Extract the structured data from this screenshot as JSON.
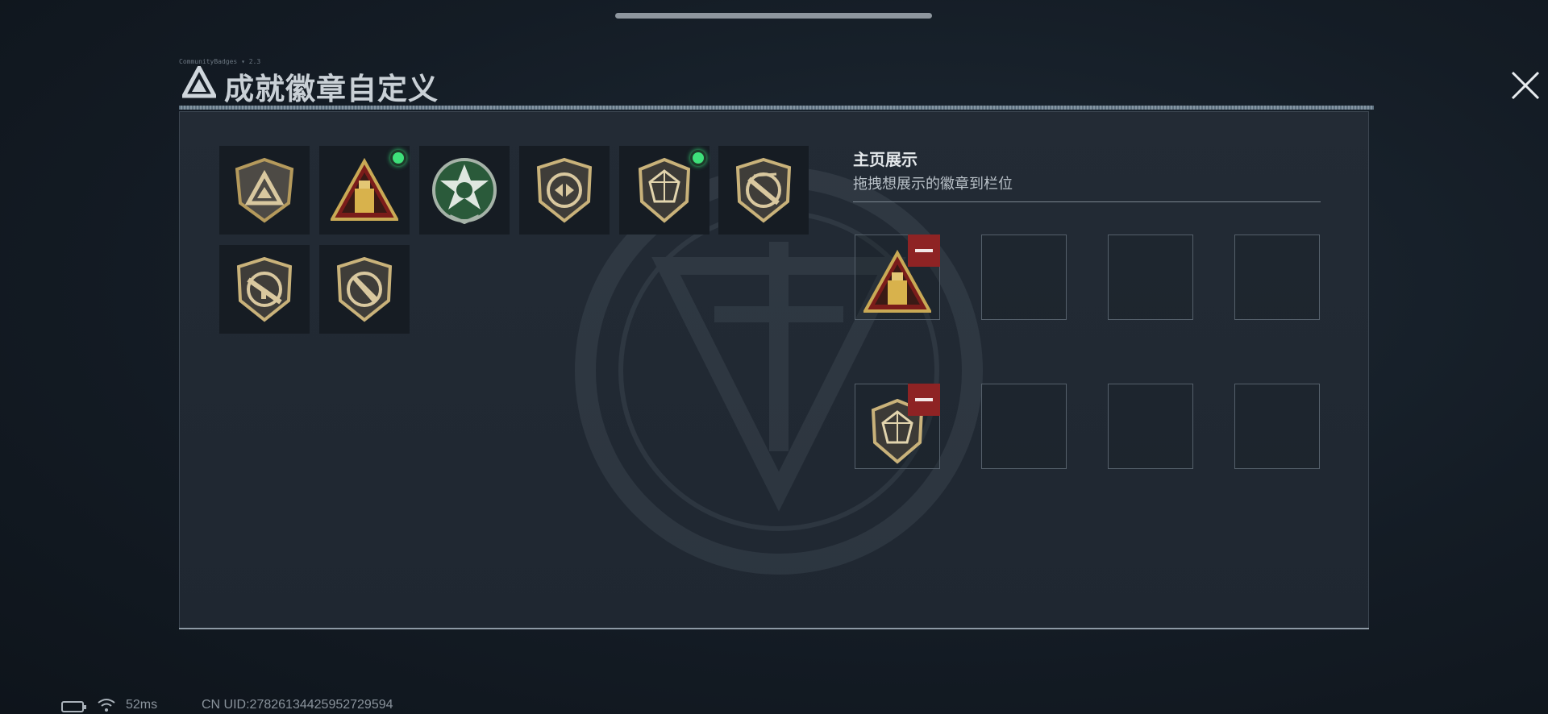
{
  "window": {
    "title": "成就徽章自定义",
    "title_tiny": "CommunityBadges ▾ 2.3"
  },
  "badges": [
    {
      "name": "shield-triangle",
      "new": false
    },
    {
      "name": "triangle-usb",
      "new": true
    },
    {
      "name": "green-star-seal",
      "new": false
    },
    {
      "name": "shield-diamond-arrows",
      "new": false
    },
    {
      "name": "shield-gem",
      "new": true
    },
    {
      "name": "shield-rifle-crossed",
      "new": false
    },
    {
      "name": "shield-rifle-circle",
      "new": false
    },
    {
      "name": "shield-knife-circle",
      "new": false
    }
  ],
  "showcase": {
    "title": "主页展示",
    "subtitle": "拖拽想展示的徽章到栏位",
    "rows": [
      [
        "triangle-usb",
        "",
        "",
        ""
      ],
      [
        "shield-gem",
        "",
        "",
        ""
      ]
    ]
  },
  "status_bar": {
    "ping": "52ms",
    "uid": "CN UID:2782613442595272959​4"
  },
  "colors": {
    "accent_green": "#3ee07a",
    "remove_red": "#8e2324",
    "badge_gold": "#b59a5c"
  }
}
